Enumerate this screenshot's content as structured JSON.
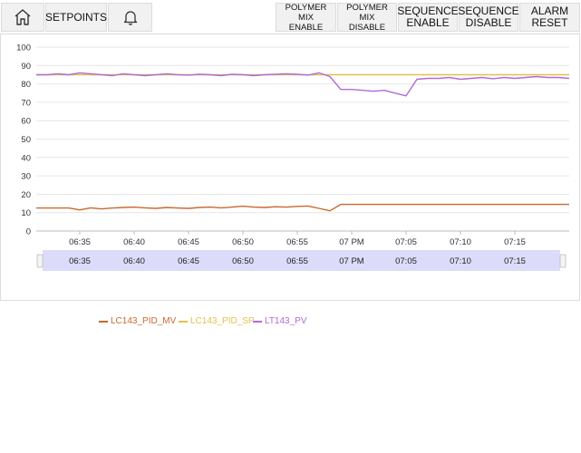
{
  "toolbar": {
    "home_icon": "home-icon",
    "setpoints_label": "SETPOINTS",
    "alarm_icon": "bell-icon",
    "polymer_enable": [
      "POLYMER MIX",
      "ENABLE"
    ],
    "polymer_disable": [
      "POLYMER MIX",
      "DISABLE"
    ],
    "sequence_enable": [
      "SEQUENCE",
      "ENABLE"
    ],
    "sequence_disable": [
      "SEQUENCE",
      "DISABLE"
    ],
    "alarm_reset": [
      "ALARM",
      "RESET"
    ]
  },
  "colors": {
    "mv": "#c8692e",
    "sp": "#e2c24a",
    "pv": "#b26ad8",
    "grid": "#e6e6e6",
    "navigator": "#dcdcfa"
  },
  "chart_data": {
    "type": "line",
    "title": "",
    "xlabel": "",
    "ylabel": "",
    "ylim": [
      0,
      100
    ],
    "yticks": [
      "0",
      "10",
      "20",
      "30",
      "40",
      "50",
      "60",
      "70",
      "80",
      "90",
      "100"
    ],
    "xticks": [
      "06:35",
      "06:40",
      "06:45",
      "06:50",
      "06:55",
      "07 PM",
      "07:05",
      "07:10",
      "07:15"
    ],
    "navigator_ticks": [
      "06:35",
      "06:40",
      "06:45",
      "06:50",
      "06:55",
      "07 PM",
      "07:05",
      "07:10",
      "07:15"
    ],
    "legend_position": "bottom",
    "x_range": [
      "06:31",
      "07:20"
    ],
    "series": [
      {
        "name": "LC143_PID_MV",
        "color_key": "mv",
        "x": [
          "06:31",
          "06:32",
          "06:33",
          "06:34",
          "06:35",
          "06:36",
          "06:37",
          "06:38",
          "06:39",
          "06:40",
          "06:41",
          "06:42",
          "06:43",
          "06:44",
          "06:45",
          "06:46",
          "06:47",
          "06:48",
          "06:49",
          "06:50",
          "06:51",
          "06:52",
          "06:53",
          "06:54",
          "06:55",
          "06:56",
          "06:57",
          "06:58",
          "06:59",
          "07:00",
          "07:05",
          "07:10",
          "07:15",
          "07:20"
        ],
        "values": [
          12.5,
          12.5,
          12.5,
          12.5,
          11.5,
          12.6,
          12,
          12.5,
          12.8,
          13,
          12.6,
          12.3,
          12.8,
          12.5,
          12.3,
          12.8,
          13,
          12.6,
          13,
          13.5,
          13,
          12.8,
          13.2,
          13,
          13.4,
          13.6,
          12.3,
          11,
          14.5,
          14.5,
          14.5,
          14.5,
          14.5,
          14.5
        ]
      },
      {
        "name": "LC143_PID_SP",
        "color_key": "sp",
        "x": [
          "06:31",
          "06:57",
          "06:58",
          "07:20"
        ],
        "values": [
          85,
          85,
          85,
          85
        ]
      },
      {
        "name": "LT143_PV",
        "color_key": "pv",
        "x": [
          "06:31",
          "06:32",
          "06:33",
          "06:34",
          "06:35",
          "06:36",
          "06:37",
          "06:38",
          "06:39",
          "06:40",
          "06:41",
          "06:42",
          "06:43",
          "06:44",
          "06:45",
          "06:46",
          "06:47",
          "06:48",
          "06:49",
          "06:50",
          "06:51",
          "06:52",
          "06:53",
          "06:54",
          "06:55",
          "06:56",
          "06:57",
          "06:58",
          "06:59",
          "07:00",
          "07:01",
          "07:02",
          "07:03",
          "07:04",
          "07:05",
          "07:06",
          "07:07",
          "07:08",
          "07:09",
          "07:10",
          "07:11",
          "07:12",
          "07:13",
          "07:14",
          "07:15",
          "07:16",
          "07:17",
          "07:18",
          "07:19",
          "07:20"
        ],
        "values": [
          85,
          85,
          85.5,
          85,
          86,
          85.5,
          85,
          84.5,
          85.5,
          85,
          84.5,
          85,
          85.5,
          85,
          84.8,
          85.2,
          85,
          84.5,
          85.2,
          85,
          84.5,
          85,
          85.2,
          85.5,
          85.2,
          84.8,
          86,
          84,
          77,
          77,
          76.5,
          76,
          76.5,
          75,
          73.5,
          82.5,
          83,
          83,
          83.5,
          82.5,
          83,
          83.5,
          82.8,
          83.5,
          83,
          83.5,
          84,
          83.5,
          83.5,
          83
        ]
      }
    ]
  }
}
